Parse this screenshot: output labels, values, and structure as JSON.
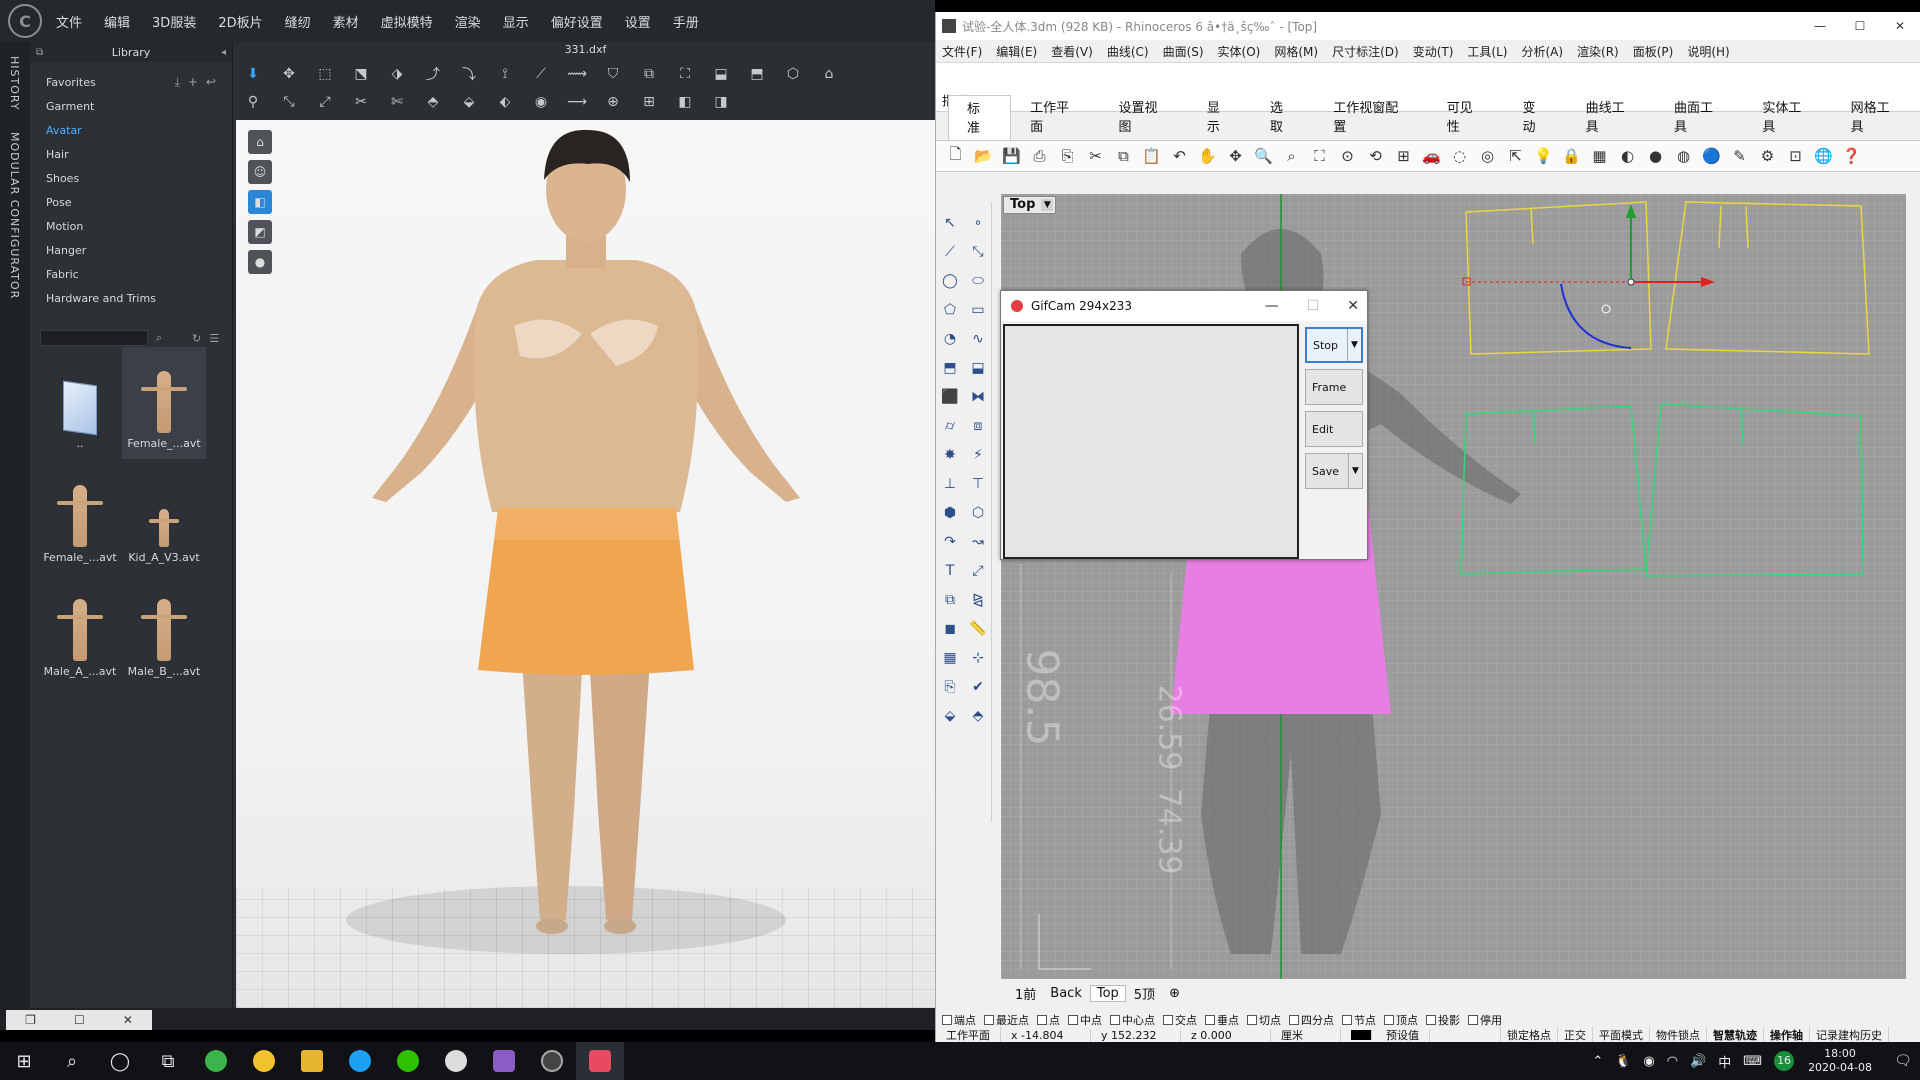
{
  "clo": {
    "menu": [
      "文件",
      "编辑",
      "3D服装",
      "2D板片",
      "缝纫",
      "素材",
      "虚拟模特",
      "渲染",
      "显示",
      "偏好设置",
      "设置",
      "手册"
    ],
    "vertical_tabs": [
      "HISTORY",
      "MODULAR CONFIGURATOR"
    ],
    "library": {
      "title": "Library",
      "items": [
        "Favorites",
        "Garment",
        "Avatar",
        "Hair",
        "Shoes",
        "Pose",
        "Motion",
        "Hanger",
        "Fabric",
        "Hardware and Trims"
      ],
      "active": "Avatar",
      "thumbnails": [
        "..",
        "Female_...avt",
        "Female_...avt",
        "Kid_A_V3.avt",
        "Male_A_...avt",
        "Male_B_...avt"
      ]
    },
    "viewport_title": "331.dxf"
  },
  "rhino": {
    "title": "试验-全人体.3dm (928 KB) - Rhinoceros 6 â•†ä¸šç‰ˆ - [Top]",
    "menu": [
      "文件(F)",
      "编辑(E)",
      "查看(V)",
      "曲线(C)",
      "曲面(S)",
      "实体(O)",
      "网格(M)",
      "尺寸标注(D)",
      "变动(T)",
      "工具(L)",
      "分析(A)",
      "渲染(R)",
      "面板(P)",
      "说明(H)"
    ],
    "command_prompt": "指令:",
    "tabs": [
      "标准",
      "工作平面",
      "设置视图",
      "显示",
      "选取",
      "工作视窗配置",
      "可见性",
      "变动",
      "曲线工具",
      "曲面工具",
      "实体工具",
      "网格工具"
    ],
    "viewport_label": "Top",
    "viewport_tabs": [
      "1前",
      "Back",
      "Top",
      "5顶"
    ],
    "viewport_dims": [
      "98.5",
      "26.59",
      "74.39"
    ],
    "snaps": [
      "端点",
      "最近点",
      "点",
      "中点",
      "中心点",
      "交点",
      "垂点",
      "切点",
      "四分点",
      "节点",
      "顶点",
      "投影",
      "停用"
    ],
    "status": {
      "workplane": "工作平面",
      "x": "x -14.804",
      "y": "y 152.232",
      "z": "z 0.000",
      "unit": "厘米",
      "layer": "预设值",
      "toggles": [
        "锁定格点",
        "正交",
        "平面模式",
        "物件锁点",
        "智慧轨迹",
        "操作轴",
        "记录建构历史"
      ]
    }
  },
  "gifcam": {
    "title": "GifCam 294x233",
    "buttons": [
      "Stop",
      "Frame",
      "Edit",
      "Save"
    ]
  },
  "taskbar": {
    "tray_lang": "中",
    "notif_count": "16",
    "time": "18:00",
    "date": "2020-04-08"
  }
}
